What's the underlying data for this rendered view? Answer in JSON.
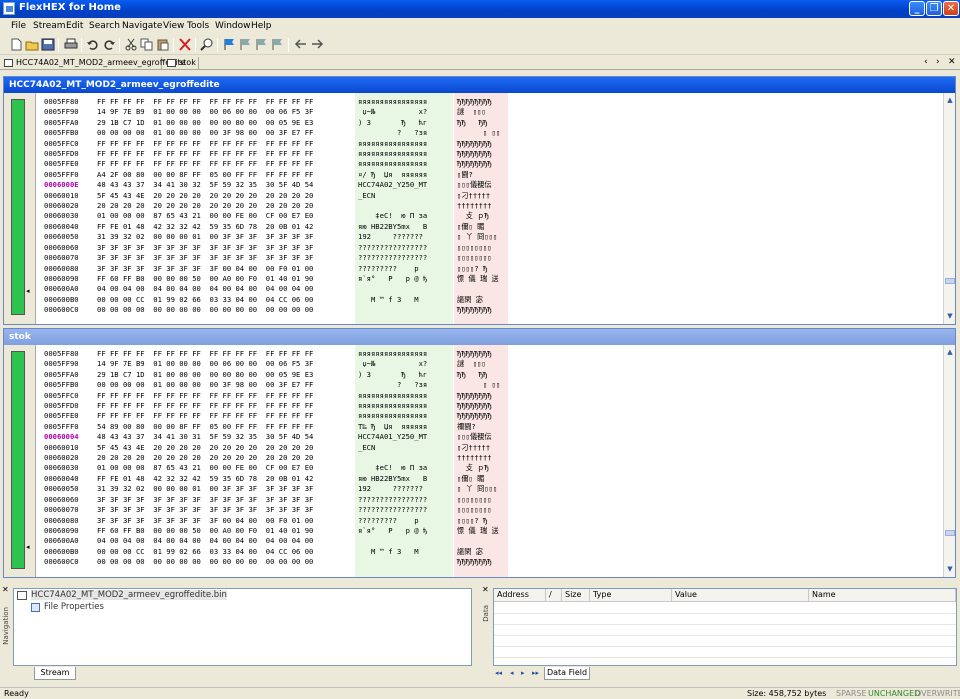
{
  "window": {
    "title": "FlexHEX for Home",
    "min": "_",
    "max": "❐",
    "close": "✕"
  },
  "menu": [
    "File",
    "Stream",
    "Edit",
    "Search",
    "Navigate",
    "View",
    "Tools",
    "Window",
    "Help"
  ],
  "toolbar_icons": [
    "new-icon",
    "open-icon",
    "save-icon",
    "print-icon",
    "undo-icon",
    "redo-icon",
    "cut-icon",
    "copy-icon",
    "paste-icon",
    "delete-icon",
    "find-icon",
    "bookmark-icon",
    "bookmark-prev-icon",
    "bookmark-next-icon",
    "bookmark-clear-icon",
    "back-icon",
    "forward-icon"
  ],
  "doc_tabs": [
    {
      "label": "HCC74A02_MT_MOD2_armeev_egroffedite"
    },
    {
      "label": "stok"
    }
  ],
  "doc_tab_controls": {
    "prev": "‹",
    "next": "›",
    "close": "✕"
  },
  "pane1": {
    "title": "HCC74A02_MT_MOD2_armeev_egroffedite",
    "offsets": [
      "0005FF80",
      "0005FF90",
      "0005FFA0",
      "0005FFB0",
      "0005FFC0",
      "0005FFD0",
      "0005FFE0",
      "0005FFF0",
      "0006000E",
      "00060010",
      "00060020",
      "00060030",
      "00060040",
      "00060050",
      "00060060",
      "00060070",
      "00060080",
      "00060090",
      "000600A0",
      "000600B0",
      "000600C0"
    ],
    "hex": [
      "FF FF FF FF  FF FF FF FF  FF FF FF FF  FF FF FF FF",
      "14 9F 7E B9  01 00 00 00  00 06 00 00  00 06 F5 3F",
      "29 1B C7 1D  01 00 00 00  00 00 80 00  00 05 9E E3",
      "00 00 00 00  01 00 00 00  00 3F 98 00  00 3F E7 FF",
      "FF FF FF FF  FF FF FF FF  FF FF FF FF  FF FF FF FF",
      "FF FF FF FF  FF FF FF FF  FF FF FF FF  FF FF FF FF",
      "FF FF FF FF  FF FF FF FF  FF FF FF FF  FF FF FF FF",
      "A4 2F 00 80  00 00 8F FF  05 00 FF FF  FF FF FF FF",
      "48 43 43 37  34 41 30 32  5F 59 32 35  30 5F 4D 54",
      "5F 45 43 4E  20 20 20 20  20 20 20 20  20 20 20 20",
      "20 20 20 20  20 20 20 20  20 20 20 20  20 20 20 20",
      "01 00 00 00  87 65 43 21  00 00 FE 00  CF 00 E7 E0",
      "FF FE 01 48  42 32 32 42  59 35 6D 78  20 0B 01 42",
      "31 39 32 02  00 00 00 01  00 3F 3F 3F  3F 3F 3F 3F",
      "3F 3F 3F 3F  3F 3F 3F 3F  3F 3F 3F 3F  3F 3F 3F 3F",
      "3F 3F 3F 3F  3F 3F 3F 3F  3F 3F 3F 3F  3F 3F 3F 3F",
      "3F 3F 3F 3F  3F 3F 3F 3F  3F 00 04 00  00 F0 01 00",
      "FF 60 FF B0  00 00 00 50  00 A0 00 F0  01 40 01 90",
      "04 00 04 00  04 00 04 00  04 00 04 00  04 00 04 00",
      "00 00 00 CC  01 99 02 66  03 33 04 00  04 CC 06 00",
      "00 00 00 00  00 00 00 00  00 00 00 00  00 00 00 00"
    ],
    "ascii": [
      "яяяяяяяяяяяяяяяя",
      " џ~№          х?",
      ") З       Ђ   ћг",
      "         ?   ?зя",
      "яяяяяяяяяяяяяяяя",
      "яяяяяяяяяяяяяяяя",
      "яяяяяяяяяяяяяяяя",
      "¤/ Ђ  Џя  яяяяяя",
      "HCC74A02_Y250_MT",
      "_ECN            ",
      "                ",
      "    ‡eC!  ю П зa",
      "яю HB22BY5mx   B",
      "192     ???????",
      "????????????????",
      "????????????????",
      "?????????    р  ",
      "я`я°   P   р @ ђ",
      "                ",
      "   M ™ f 3   M  ",
      "                "
    ],
    "ebcdic": [
      "ЂЂЂЂЂЂЂЂ",
      "謎  ▯▯▯",
      "ЂЂ   ЂЂ",
      "      ▯ ▯▯",
      "ЂЂЂЂЂЂЂЂ",
      "ЂЂЂЂЂЂЂЂ",
      "ЂЂЂЂЂЂЂЂ",
      "▯闘?",
      "▯▯▯儀覩伝",
      "▯刁†††††",
      "††††††††",
      "  攴 ｐЂ",
      "▯儞▯ 睸",
      "▯ 丫 冏▯▯▯",
      "▯▯▯▯▯▯▯▯",
      "▯▯▯▯▯▯▯▯",
      "▯▯▯▯? Ђ",
      "憬 儀 瑞 送",
      "         ",
      "謳閑 宓",
      "ЂЂЂЂЂЂЂЂ"
    ]
  },
  "pane2": {
    "title": "stok",
    "offsets": [
      "0005FF80",
      "0005FF90",
      "0005FFA0",
      "0005FFB0",
      "0005FFC0",
      "0005FFD0",
      "0005FFE0",
      "0005FFF0",
      "00060004",
      "00060010",
      "00060020",
      "00060030",
      "00060040",
      "00060050",
      "00060060",
      "00060070",
      "00060080",
      "00060090",
      "000600A0",
      "000600B0",
      "000600C0"
    ],
    "hex": [
      "FF FF FF FF  FF FF FF FF  FF FF FF FF  FF FF FF FF",
      "14 9F 7E B9  01 00 00 00  00 06 00 00  00 06 F5 3F",
      "29 1B C7 1D  01 00 00 00  00 00 80 00  00 05 9E E3",
      "00 00 00 00  01 00 00 00  00 3F 98 00  00 3F E7 FF",
      "FF FF FF FF  FF FF FF FF  FF FF FF FF  FF FF FF FF",
      "FF FF FF FF  FF FF FF FF  FF FF FF FF  FF FF FF FF",
      "FF FF FF FF  FF FF FF FF  FF FF FF FF  FF FF FF FF",
      "54 89 00 80  00 00 8F FF  05 00 FF FF  FF FF FF FF",
      "48 43 43 37  34 41 30 31  5F 59 32 35  30 5F 4D 54",
      "5F 45 43 4E  20 20 20 20  20 20 20 20  20 20 20 20",
      "20 20 20 20  20 20 20 20  20 20 20 20  20 20 20 20",
      "01 00 00 00  87 65 43 21  00 00 FE 00  CF 00 E7 E0",
      "FF FE 01 48  42 32 32 42  59 35 6D 78  20 0B 01 42",
      "31 39 32 02  00 00 00 01  00 3F 3F 3F  3F 3F 3F 3F",
      "3F 3F 3F 3F  3F 3F 3F 3F  3F 3F 3F 3F  3F 3F 3F 3F",
      "3F 3F 3F 3F  3F 3F 3F 3F  3F 3F 3F 3F  3F 3F 3F 3F",
      "3F 3F 3F 3F  3F 3F 3F 3F  3F 00 04 00  00 F0 01 00",
      "FF 60 FF B0  00 00 00 50  00 A0 00 F0  01 40 01 90",
      "04 00 04 00  04 00 04 00  04 00 04 00  04 00 04 00",
      "00 00 00 CC  01 99 02 66  03 33 04 00  04 CC 06 00",
      "00 00 00 00  00 00 00 00  00 00 00 00  00 00 00 00"
    ],
    "ascii": [
      "яяяяяяяяяяяяяяяя",
      " џ~№          х?",
      ") З       Ђ   ћг",
      "         ?   ?зя",
      "яяяяяяяяяяяяяяяя",
      "яяяяяяяяяяяяяяяя",
      "яяяяяяяяяяяяяяяя",
      "T‰ Ђ  Џя  яяяяяя",
      "HCC74A01_Y250_MT",
      "_ECN            ",
      "                ",
      "    ‡eC!  ю П зa",
      "яю HB22BY5mx   B",
      "192     ???????",
      "????????????????",
      "????????????????",
      "?????????    р  ",
      "я`я°   P   р @ ђ",
      "                ",
      "   M ™ f 3   M  ",
      "                "
    ],
    "ebcdic": [
      "ЂЂЂЂЂЂЂЂ",
      "謎  ▯▯▯",
      "ЂЂ   ЂЂ",
      "      ▯ ▯▯",
      "ЂЂЂЂЂЂЂЂ",
      "ЂЂЂЂЂЂЂЂ",
      "ЂЂЂЂЂЂЂЂ",
      "禰闘?",
      "▯▯▯儀覩伝",
      "▯刁†††††",
      "††††††††",
      "  攴 ｐЂ",
      "▯儞▯ 睸",
      "▯ 丫 冏▯▯▯",
      "▯▯▯▯▯▯▯▯",
      "▯▯▯▯▯▯▯▯",
      "▯▯▯▯? Ђ",
      "憬 儀 瑞 送",
      "         ",
      "謳閑 宓",
      "ЂЂЂЂЂЂЂЂ"
    ]
  },
  "navigation": {
    "vertical_label": "Navigation",
    "close": "✕",
    "file": "HCC74A02_MT_MOD2_armeev_egroffedite.bin",
    "child": "File Properties",
    "tab": "Stream"
  },
  "datafield": {
    "vertical_label": "Data",
    "close": "✕",
    "columns": [
      "Address",
      "/",
      "Size",
      "Type",
      "Value",
      "Name"
    ],
    "tab": "Data Field",
    "nav": [
      "◂◂",
      "◂",
      "▸",
      "▸▸"
    ]
  },
  "status": {
    "left": "Ready",
    "size": "Size: 458,752 bytes",
    "sparse": "SPARSE",
    "unchanged": "UNCHANGED",
    "overwrite": "OVERWRITE"
  },
  "colors": {
    "title_active": "#0A47D0",
    "title_inactive": "#7F9FE0",
    "highlight_offset": "#B000B0",
    "ascii_bg": "#E8F6E4",
    "ebcdic_bg": "#FBE6E6",
    "unchanged": "#2E8B2E"
  }
}
